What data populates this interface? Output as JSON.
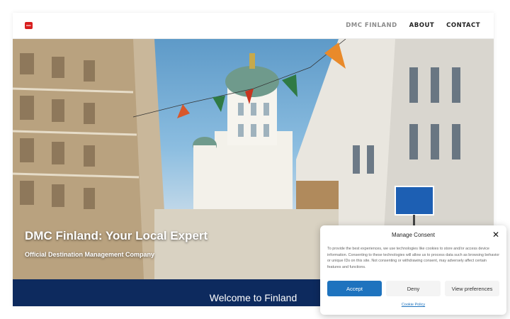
{
  "header": {
    "logo_text": "DMC",
    "nav": [
      {
        "label": "DMC FINLAND",
        "active": true
      },
      {
        "label": "ABOUT",
        "active": false
      },
      {
        "label": "CONTACT",
        "active": false
      }
    ]
  },
  "hero": {
    "title": "DMC Finland: Your Local Expert",
    "subtitle": "Official Destination Management Company"
  },
  "welcome": {
    "text": "Welcome to Finland"
  },
  "consent": {
    "title": "Manage Consent",
    "body": "To provide the best experiences, we use technologies like cookies to store and/or access device information. Consenting to these technologies will allow us to process data such as browsing behavior or unique IDs on this site. Not consenting or withdrawing consent, may adversely affect certain features and functions.",
    "accept_label": "Accept",
    "deny_label": "Deny",
    "prefs_label": "View preferences",
    "policy_link": "Cookie Policy",
    "close_icon": "close-icon"
  },
  "colors": {
    "accent": "#1e73be",
    "band": "#0d2a5e",
    "logo": "#d81f1f"
  }
}
